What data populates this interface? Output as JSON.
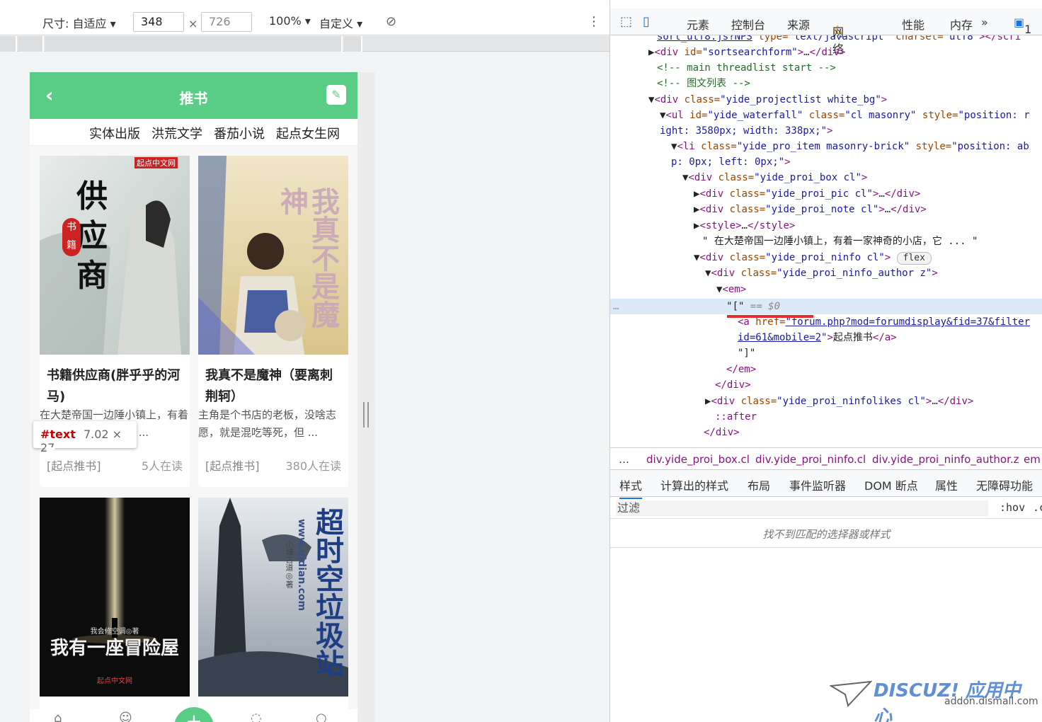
{
  "device_toolbar": {
    "dimensions_label": "尺寸: 自适应",
    "width": "348",
    "times": "×",
    "height": "726",
    "zoom": "100%",
    "throttle": "自定义"
  },
  "phone": {
    "header_title": "推书",
    "back_icon": "‹",
    "tabs": [
      "实体出版",
      "洪荒文学",
      "番茄小说",
      "起点女生网"
    ],
    "books": [
      {
        "title": "书籍供应商(胖乎乎的河马)",
        "desc": "在大楚帝国一边陲小镇上，有着一家神奇的小店，它 ...",
        "source": "[起点推书]",
        "readers": "5人在读",
        "cover_title": "供应商",
        "cover_badge": "书籍",
        "cover_publisher": "起点中文网"
      },
      {
        "title": "我真不是魔神（要离刺荆轲）",
        "desc": "主角是个书店的老板，没啥志愿，就是混吃等死，但 ...",
        "source": "[起点推书]",
        "readers": "380人在读",
        "cover_title": "我真不是魔神"
      },
      {
        "title": "",
        "cover_title": "我有一座冒险屋",
        "cover_author": "我会修空调◎著",
        "cover_publisher": "起点中文网"
      },
      {
        "title": "",
        "cover_title": "超时空垃圾站",
        "cover_site": "www.qidian.com",
        "cover_author": "小城古道◎著"
      }
    ],
    "tooltip": {
      "node": "#text",
      "size": "7.02 × 27"
    }
  },
  "devtools": {
    "tabs": [
      "元素",
      "控制台",
      "来源",
      "网络",
      "性能",
      "内存"
    ],
    "warning_count": "",
    "issue_count": "1",
    "code_lines": [
      "sort_utf8.js?NPS\" type=\"text/javascript\" charset=\"utf8\"></scri",
      "▶<div id=\"sortsearchform\">…</div>",
      "<!-- main threadlist start -->",
      "<!-- 图文列表 -->",
      "▼<div class=\"yide_projectlist white_bg\">",
      "▼<ul id=\"yide_waterfall\" class=\"cl masonry\" style=\"position: r",
      "ight: 3580px; width: 338px;\">",
      "▼<li class=\"yide_pro_item masonry-brick\" style=\"position: ab",
      "p: 0px; left: 0px;\">",
      "▼<div class=\"yide_proi_box cl\">",
      "▶<div class=\"yide_proi_pic cl\">…</div>",
      "▶<div class=\"yide_proi_note cl\">…</div>",
      "▶<style>…</style>",
      "\" 在大楚帝国一边陲小镇上，有着一家神奇的小店，它 ... \"",
      "▼<div class=\"yide_proi_ninfo cl\">",
      "▼<div class=\"yide_proi_ninfo_author z\">",
      "▼<em>",
      "\"[\" == $0",
      "<a href=\"forum.php?mod=forumdisplay&fid=37&filter",
      "id=61&mobile=2\">起点推书</a>",
      "\"]\"",
      "</em>",
      "</div>",
      "▶<div class=\"yide_proi_ninfolikes cl\">…</div>",
      "::after",
      "</div>"
    ],
    "flex_badge": "flex",
    "breadcrumbs": [
      "…",
      "div.yide_proi_box.cl",
      "div.yide_proi_ninfo.cl",
      "div.yide_proi_ninfo_author.z",
      "em"
    ],
    "style_tabs": [
      "样式",
      "计算出的样式",
      "布局",
      "事件监听器",
      "DOM 断点",
      "属性",
      "无障碍功能"
    ],
    "filter_placeholder": "过滤",
    "hov": ":hov",
    "cls": ".c",
    "no_match": "找不到匹配的选择器或样式"
  },
  "watermark": {
    "brand": "DISCUZ! 应用中心",
    "url": "addon.dismall.com"
  },
  "colors": {
    "green": "#59cd85",
    "devtools_selection": "#dce9f8",
    "tag": "#881280",
    "attr": "#994500",
    "value": "#1a1aa6"
  }
}
